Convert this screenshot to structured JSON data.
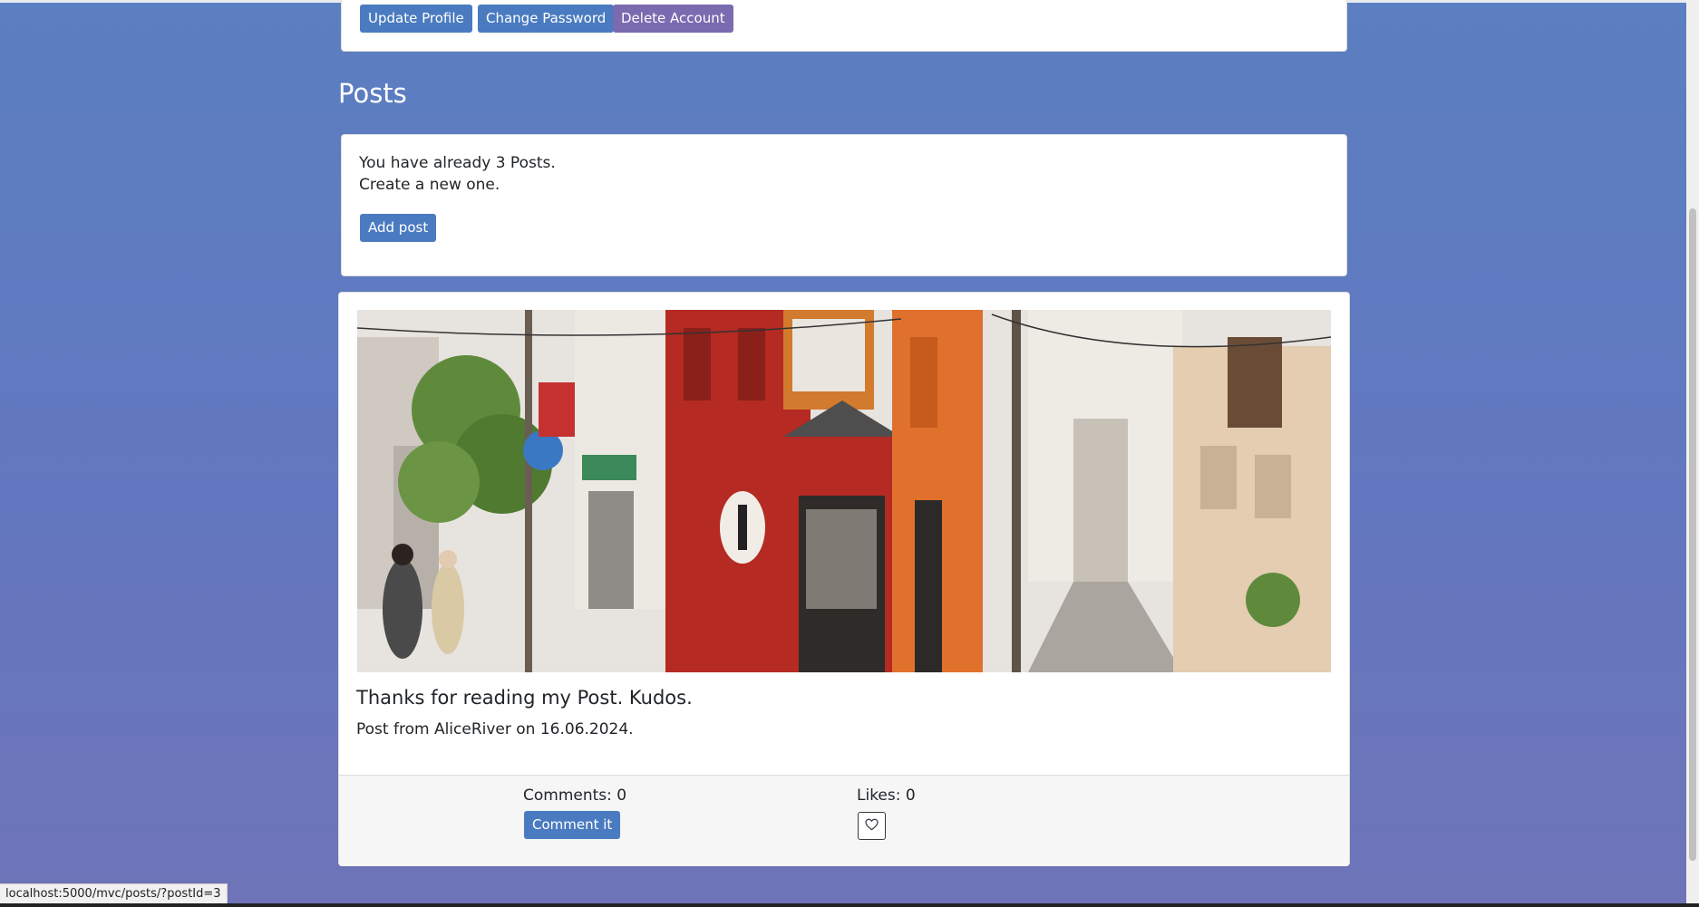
{
  "profile_actions": {
    "update_profile": "Update Profile",
    "change_password": "Change Password",
    "delete_account": "Delete Account"
  },
  "posts_section": {
    "heading": "Posts",
    "summary_line1": "You have already 3 Posts.",
    "summary_line2": "Create a new one.",
    "add_post_label": "Add post"
  },
  "post": {
    "title": "Thanks for reading my Post. Kudos.",
    "meta": "Post from AliceRiver on 16.06.2024.",
    "comments_label": "Comments: 0",
    "comment_button": "Comment it",
    "likes_label": "Likes: 0"
  },
  "status_bar": {
    "url": "localhost:5000/mvc/posts/?postId=3"
  },
  "colors": {
    "button_primary": "#4a7bc0",
    "button_danger": "#7a6ab0",
    "background_top": "#5b7fc1",
    "background_bottom": "#6f74b8"
  },
  "icons": {
    "like": "heart-outline-icon"
  }
}
